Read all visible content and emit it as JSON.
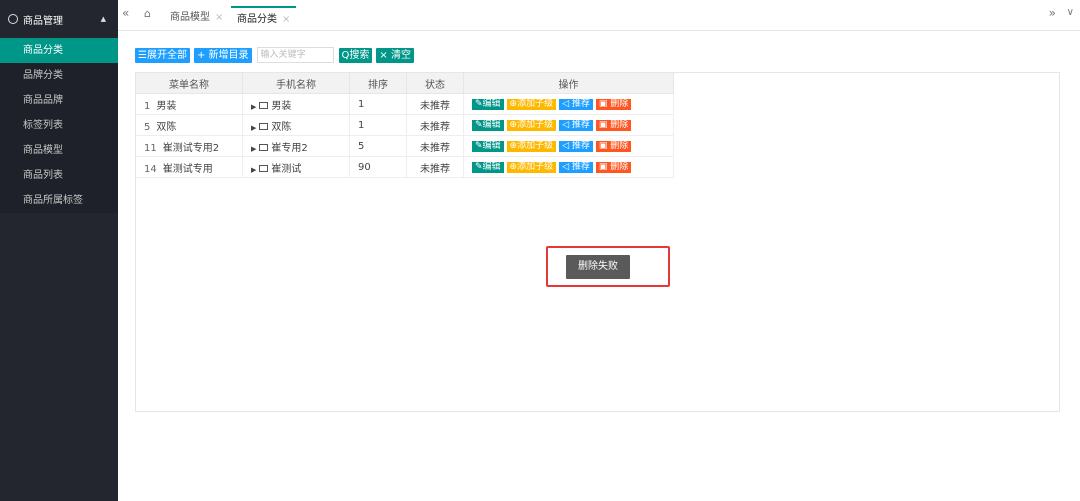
{
  "sidebar": {
    "group_title": "商品管理",
    "items": [
      {
        "label": "商品分类",
        "active": true
      },
      {
        "label": "品牌分类"
      },
      {
        "label": "商品品牌"
      },
      {
        "label": "标签列表"
      },
      {
        "label": "商品模型"
      },
      {
        "label": "商品列表"
      },
      {
        "label": "商品所属标签"
      }
    ]
  },
  "tabs": {
    "prev_icon": "«",
    "next_icon": "»",
    "menu_icon": "∨",
    "items": [
      {
        "label": "商品模型"
      },
      {
        "label": "商品分类",
        "active": true
      }
    ]
  },
  "toolbar": {
    "expand_all": "☰展开全部",
    "add_dir": "+ 新增目录",
    "search_placeholder": "输入关键字",
    "search": "Q搜索",
    "clear": "× 清空"
  },
  "table": {
    "headers": [
      "菜单名称",
      "手机名称",
      "排序",
      "状态",
      "操作"
    ],
    "rows": [
      {
        "id": "1",
        "name": "男装",
        "phone": "男装",
        "sort": "1",
        "status": "未推荐"
      },
      {
        "id": "5",
        "name": "双陈",
        "phone": "双陈",
        "sort": "1",
        "status": "未推荐"
      },
      {
        "id": "11",
        "name": "崔测试专用2",
        "phone": "崔专用2",
        "sort": "5",
        "status": "未推荐"
      },
      {
        "id": "14",
        "name": "崔测试专用",
        "phone": "崔测试",
        "sort": "90",
        "status": "未推荐"
      }
    ],
    "ops": {
      "edit": "✎编辑",
      "add_child": "⊕添加子级",
      "recommend": "◁ 推荐",
      "delete": "▣ 删除"
    }
  },
  "toast": {
    "message": "删除失败"
  },
  "colors": {
    "accent": "#009688",
    "blue": "#1e9fff",
    "orange": "#ffb800",
    "red": "#ff5722",
    "highlight_border": "#e53935"
  }
}
